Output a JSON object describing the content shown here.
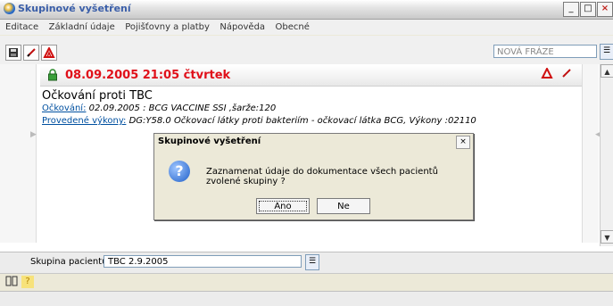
{
  "window": {
    "title": "Skupinové vyšetření",
    "buttons": {
      "minimize": "_",
      "maximize": "□",
      "close": "×"
    }
  },
  "menu": {
    "items": [
      "Editace",
      "Základní údaje",
      "Pojišťovny a platby",
      "Nápověda",
      "Obecné"
    ]
  },
  "toolbar": {
    "icons": [
      "save-icon",
      "edit-pen-icon",
      "record-icon"
    ],
    "search_placeholder": "NOVÁ FRÁZE"
  },
  "record": {
    "header": "08.09.2005 21:05 čtvrtek",
    "title": "Očkování proti TBC",
    "line1_label": "Očkování:",
    "line1_value": " 02.09.2005 : BCG VACCINE SSI ,šarže:120",
    "line2_label": "Provedené výkony:",
    "line2_value": " DG:Y58.0 Očkovací látky proti bakteriím - očkovací látka BCG, Výkony :02110"
  },
  "dialog": {
    "title": "Skupinové vyšetření",
    "message": "Zaznamenat údaje do dokumentace všech pacientů zvolené skupiny ?",
    "yes_label": "Ano",
    "no_label": "Ne",
    "icon": "question-icon"
  },
  "patient_group": {
    "label": "Skupina pacientů :",
    "value": "TBC 2.9.2005"
  },
  "colors": {
    "header_red": "#e0101a",
    "link_blue": "#0050a0",
    "title_blue": "#3a5ea8"
  }
}
